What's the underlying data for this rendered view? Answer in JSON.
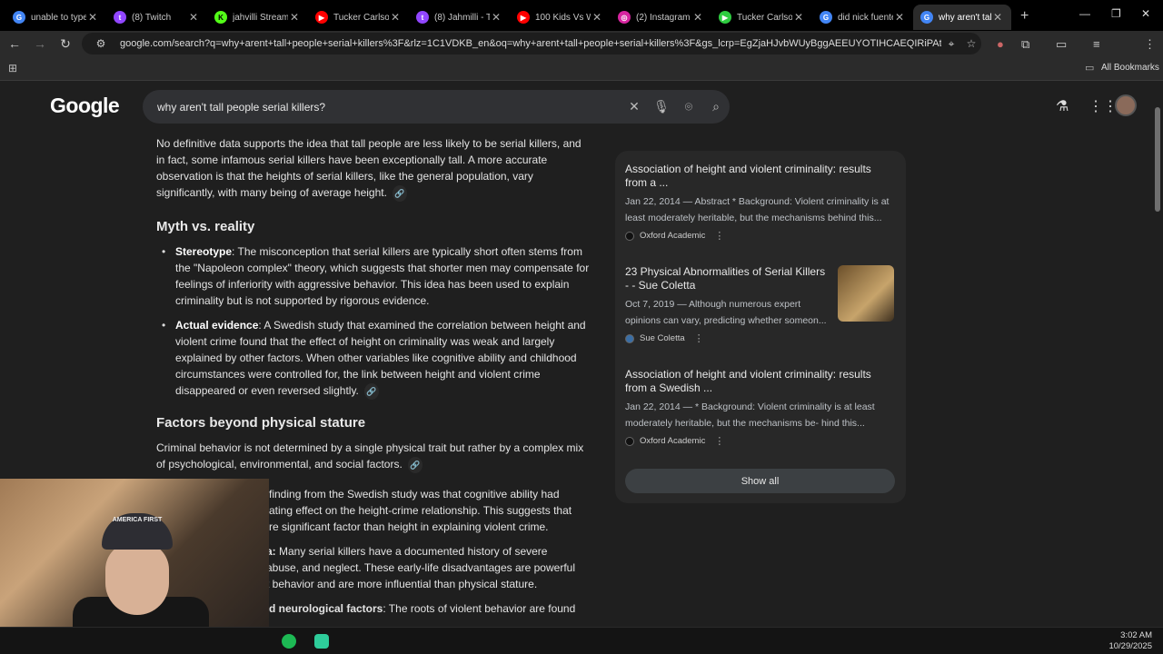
{
  "browser": {
    "tabs": [
      {
        "title": "unable to type",
        "color": "#4285f4",
        "glyph": "G"
      },
      {
        "title": "(8) Twitch",
        "color": "#9146ff",
        "glyph": "t"
      },
      {
        "title": "jahvilli Stream",
        "color": "#53fc18",
        "glyph": "K"
      },
      {
        "title": "Tucker Carlson",
        "color": "#ff0000",
        "glyph": "▶"
      },
      {
        "title": "(8) Jahmilli - T",
        "color": "#9146ff",
        "glyph": "t"
      },
      {
        "title": "100 Kids Vs W",
        "color": "#ff0000",
        "glyph": "▶"
      },
      {
        "title": "(2) Instagram",
        "color": "#d6249f",
        "glyph": "◎"
      },
      {
        "title": "Tucker Carlson",
        "color": "#2ecc40",
        "glyph": "▶"
      },
      {
        "title": "did nick fuente",
        "color": "#4285f4",
        "glyph": "G"
      },
      {
        "title": "why aren't tall",
        "color": "#4285f4",
        "glyph": "G"
      }
    ],
    "new_tab": "+",
    "url": "google.com/search?q=why+arent+tall+people+serial+killers%3F&rlz=1C1VDKB_en&oq=why+arent+tall+people+serial+killers%3F&gs_lcrp=EgZjaHJvbWUyBggAEEUYOTIHCAEQIRiPAtIBCDUwN...",
    "all_bookmarks": "All Bookmarks"
  },
  "google": {
    "logo": "Google",
    "query": "why aren't tall people serial killers?"
  },
  "main": {
    "intro": "No definitive data supports the idea that tall people are less likely to be serial killers, and in fact, some infamous serial killers have been exceptionally tall. A more accurate observation is that the heights of serial killers, like the general population, vary significantly, with many being of average height.",
    "section1_title": "Myth vs. reality",
    "bullet1_label": "Stereotype",
    "bullet1_text": ": The misconception that serial killers are typically short often stems from the \"Napoleon complex\" theory, which suggests that shorter men may compensate for feelings of inferiority with aggressive behavior. This idea has been used to explain criminality but is not supported by rigorous evidence.",
    "bullet2_label": "Actual evidence",
    "bullet2_text": ": A Swedish study that examined the correlation between height and violent crime found that the effect of height on criminality was weak and largely explained by other factors. When other variables like cognitive ability and childhood circumstances were controlled for, the link between height and violent crime disappeared or even reversed slightly.",
    "section2_title": "Factors beyond physical stature",
    "section2_intro": "Criminal behavior is not determined by a single physical trait but rather by a complex mix of psychological, environmental, and social factors.",
    "partial1": "finding from the Swedish study was that cognitive ability had",
    "partial2": "ating effect on the height-crime relationship. This suggests that",
    "partial3": "re significant factor than height in explaining violent crime.",
    "partial4_label": "a:",
    "partial4": " Many serial killers have a documented history of severe",
    "partial5": "abuse, and neglect. These early-life disadvantages are powerful",
    "partial6": "t behavior and are more influential than physical stature.",
    "partial7_label": "d neurological factors",
    "partial7": ": The roots of violent behavior are found"
  },
  "sources": [
    {
      "title": "Association of height and violent criminality: results from a ...",
      "snippet": "Jan 22, 2014 — Abstract * Background: Violent criminality is at least moderately heritable, but the mechanisms behind this...",
      "site": "Oxford Academic"
    },
    {
      "title": "23 Physical Abnormalities of Serial Killers - - Sue Coletta",
      "snippet": "Oct 7, 2019 — Although numerous expert opinions can vary, predicting whether someon...",
      "site": "Sue Coletta"
    },
    {
      "title": "Association of height and violent criminality: results from a Swedish ...",
      "snippet": "Jan 22, 2014 — * Background: Violent criminality is at least moderately heritable, but the mechanisms be- hind this...",
      "site": "Oxford Academic"
    }
  ],
  "show_all": "Show all",
  "webcam": {
    "cap_text": "AMERICA FIRST"
  },
  "clock": {
    "time": "3:02 AM",
    "date": "10/29/2025"
  }
}
